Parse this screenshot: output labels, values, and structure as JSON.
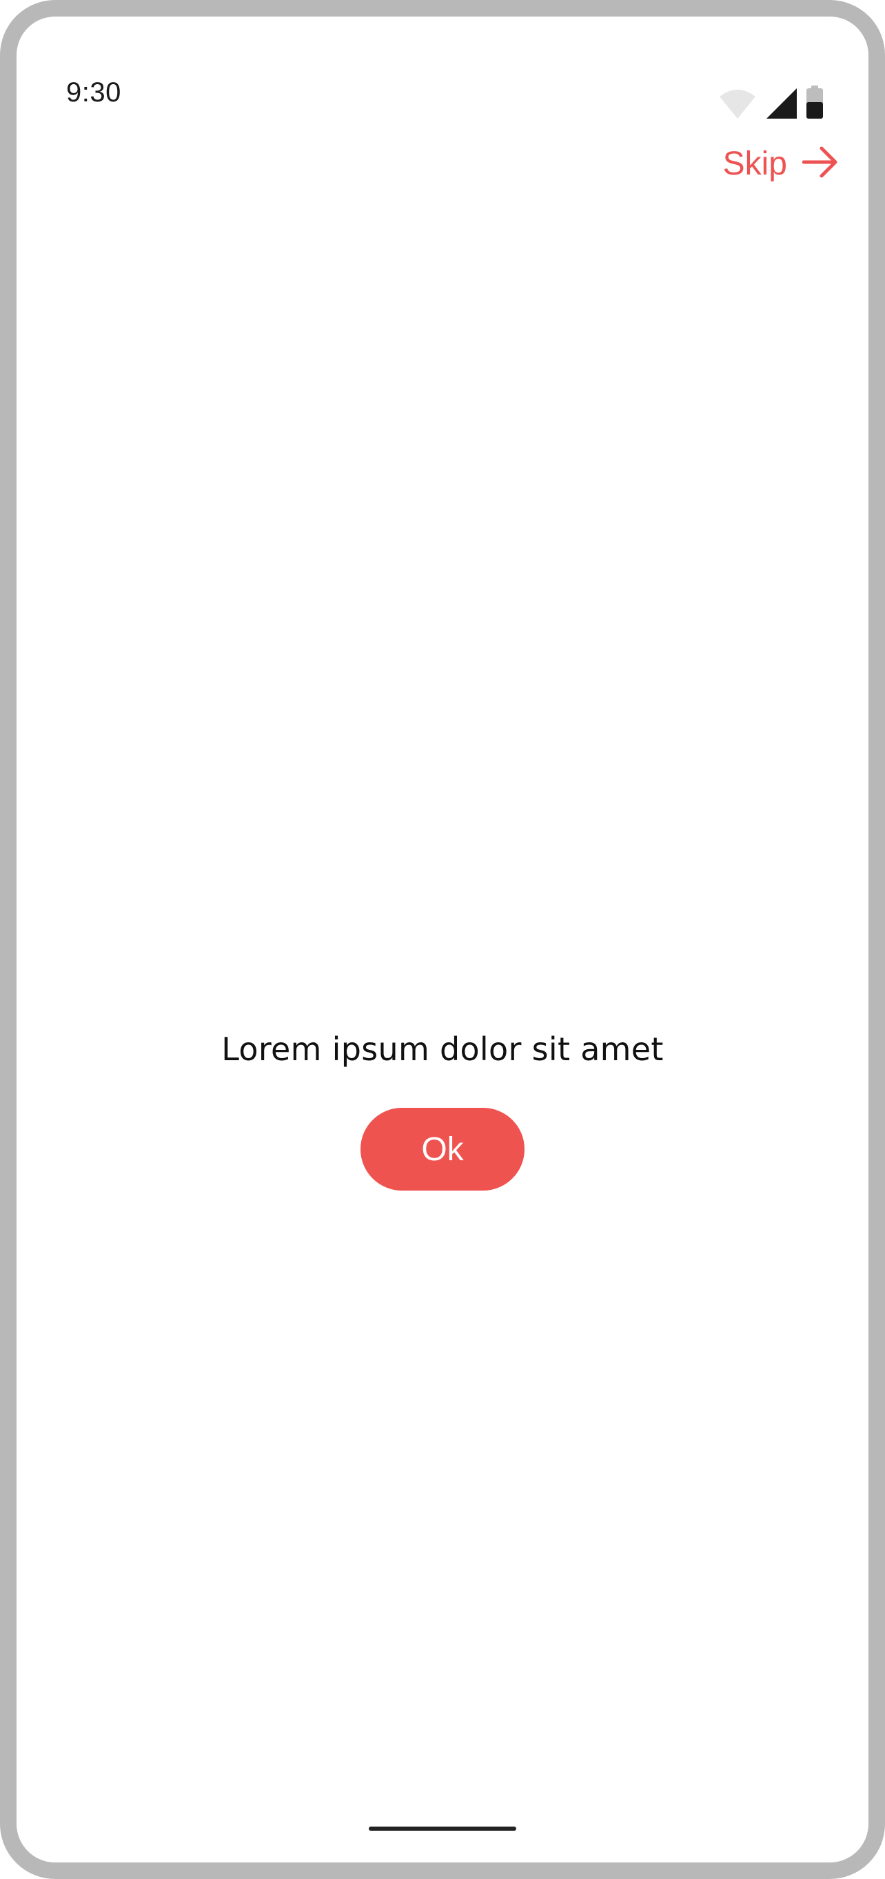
{
  "status_bar": {
    "time": "9:30",
    "icons": [
      "wifi-icon",
      "cellular-signal-icon",
      "battery-icon"
    ]
  },
  "header": {
    "skip_label": "Skip",
    "skip_icon": "arrow-right-icon"
  },
  "main": {
    "message": "Lorem ipsum dolor sit amet",
    "ok_label": "Ok"
  },
  "colors": {
    "accent": "#ef5350",
    "frame": "#b8b8b8",
    "background": "#ffffff",
    "text": "#111111"
  }
}
